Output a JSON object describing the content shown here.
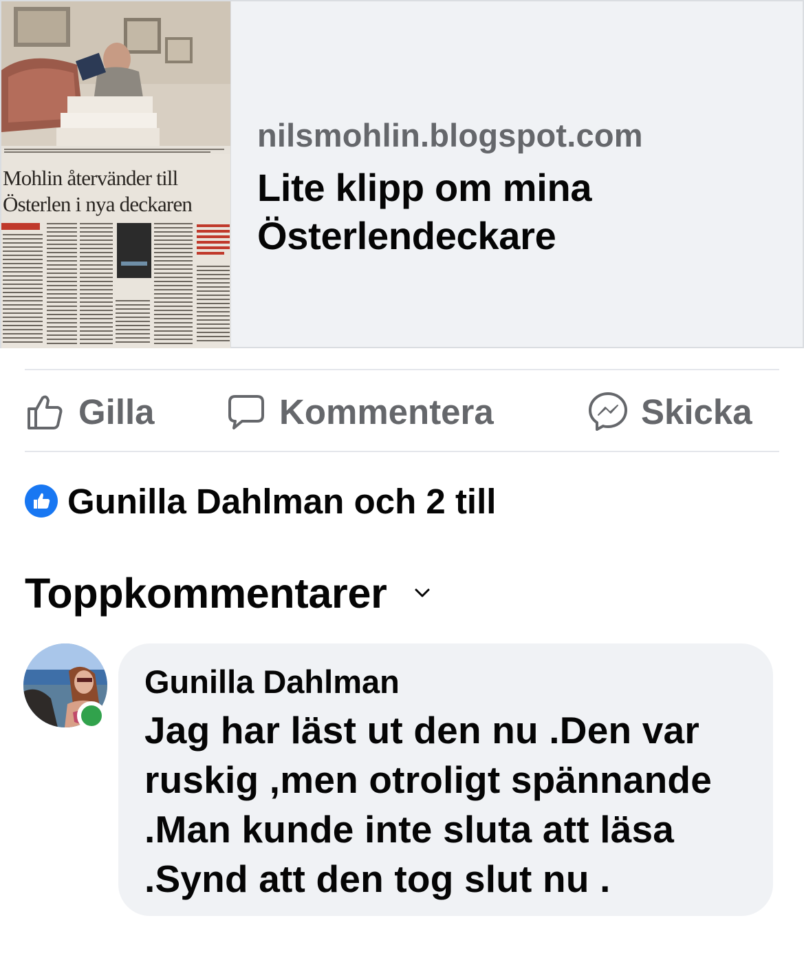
{
  "link_preview": {
    "thumbnail_headline_line1": "Mohlin återvänder till",
    "thumbnail_headline_line2": "Österlen i nya deckaren",
    "domain": "nilsmohlin.blogspot.com",
    "title": "Lite klipp om mina Österlendeckare"
  },
  "actions": {
    "like_label": "Gilla",
    "comment_label": "Kommentera",
    "send_label": "Skicka"
  },
  "reactions": {
    "summary": "Gunilla Dahlman och 2 till",
    "icon": "like-icon"
  },
  "comments_header": {
    "label": "Toppkommentarer",
    "icon": "chevron-down-icon"
  },
  "comments": [
    {
      "author": "Gunilla Dahlman",
      "text": "Jag har läst ut den nu .Den var ruskig ,men otroligt spännande .Man kunde inte sluta att läsa .Synd att den tog slut nu .",
      "online": true
    }
  ],
  "colors": {
    "accent": "#1877f2",
    "secondary_text": "#65676b",
    "online": "#31a24c",
    "bubble_bg": "#f0f2f5"
  }
}
